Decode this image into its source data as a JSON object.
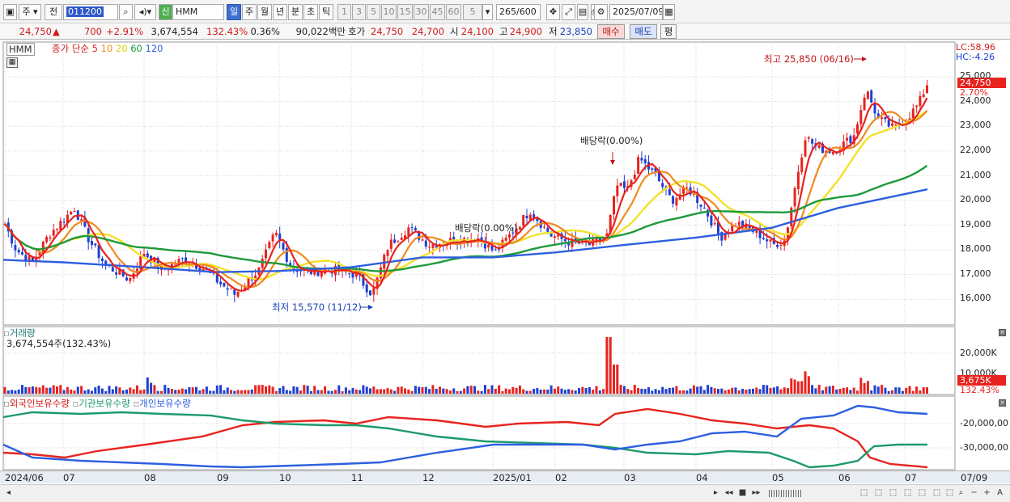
{
  "toolbar": {
    "layout_icon": "window-layout-icon",
    "period_select": "주",
    "prev_label": "전",
    "stock_code": "011200",
    "new_label": "신",
    "stock_name": "HMM",
    "period_tabs": [
      "일",
      "주",
      "월",
      "년",
      "분",
      "초",
      "틱"
    ],
    "active_period": "일",
    "interval_buttons": [
      "1",
      "3",
      "5",
      "10",
      "15",
      "30",
      "45",
      "60"
    ],
    "interval_value": "5",
    "data_count": "265",
    "data_max": "/600",
    "date": "2025/07/09"
  },
  "quote": {
    "price": "24,750",
    "change": "700",
    "change_rate": "+2.91%",
    "volume": "3,674,554",
    "volume_ratio": "132.43%",
    "turnover": "0.36%",
    "amount": "90,022백만",
    "bid_label": "호가",
    "bid_ask": "24,750",
    "bid_bid": "24,700",
    "open_label": "시",
    "open": "24,100",
    "high_label": "고",
    "high": "24,900",
    "low_label": "저",
    "low": "23,850",
    "buy_button": "매수",
    "sell_button": "매도",
    "eval_button": "평"
  },
  "price_panel": {
    "stock_tag": "HMM",
    "ma_title": "종가 단순",
    "ma_periods": [
      "5",
      "10",
      "20",
      "60",
      "120"
    ],
    "lc": "LC:58.96",
    "hc": "HC:-4.26",
    "high_annotation": "최고 25,850 (06/16)",
    "low_annotation": "최저 15,570 (11/12)",
    "dividend_1": "배당락(0.00%)",
    "dividend_2": "배당락(0.00%)",
    "current_tag": "24,750",
    "current_pct": "2.70%",
    "y_ticks": [
      "25,000",
      "24,000",
      "23,000",
      "22,000",
      "21,000",
      "20,000",
      "19,000",
      "18,000",
      "17,000",
      "16,000"
    ]
  },
  "volume_panel": {
    "title": "거래량",
    "value": "3,674,554주(132.43%)",
    "y_ticks": [
      "20,000K",
      "10,000K"
    ],
    "current_tag": "3,675K",
    "current_pct": "132.43%"
  },
  "holdings_panel": {
    "legends": [
      "외국인보유수량",
      "기관보유수량",
      "개인보유수량"
    ],
    "y_ticks": [
      "-20,000,00",
      "-30,000,00"
    ]
  },
  "x_axis": {
    "labels": [
      "2024/06",
      "07",
      "08",
      "09",
      "10",
      "11",
      "12",
      "2025/01",
      "02",
      "03",
      "04",
      "05",
      "06",
      "07"
    ],
    "right_label": "07/09"
  },
  "colors": {
    "up": "#e8231f",
    "down": "#1f3fd0",
    "ma5": "#e8231f",
    "ma10": "#f08a1e",
    "ma20": "#f3e12a",
    "ma60": "#1e9a3a",
    "ma120": "#2d5fe0",
    "foreign": "#e8231f",
    "institution": "#1e9a6a",
    "individual": "#2d5fe0"
  },
  "chart_data": {
    "type": "candlestick",
    "x": [
      "2024/06",
      "07",
      "08",
      "09",
      "10",
      "11",
      "12",
      "2025/01",
      "02",
      "03",
      "04",
      "05",
      "06",
      "07"
    ],
    "close": [
      18700,
      19700,
      17400,
      16900,
      17100,
      16200,
      18500,
      18000,
      18300,
      21600,
      18800,
      18600,
      24000,
      24750
    ],
    "ma120": [
      17600,
      17500,
      17300,
      17100,
      17150,
      17300,
      17700,
      17700,
      17900,
      18200,
      18500,
      18900,
      19700,
      20450
    ],
    "ylim": [
      15500,
      26000
    ],
    "high": {
      "value": 25850,
      "date": "06/16"
    },
    "low": {
      "value": 15570,
      "date": "11/12"
    }
  }
}
